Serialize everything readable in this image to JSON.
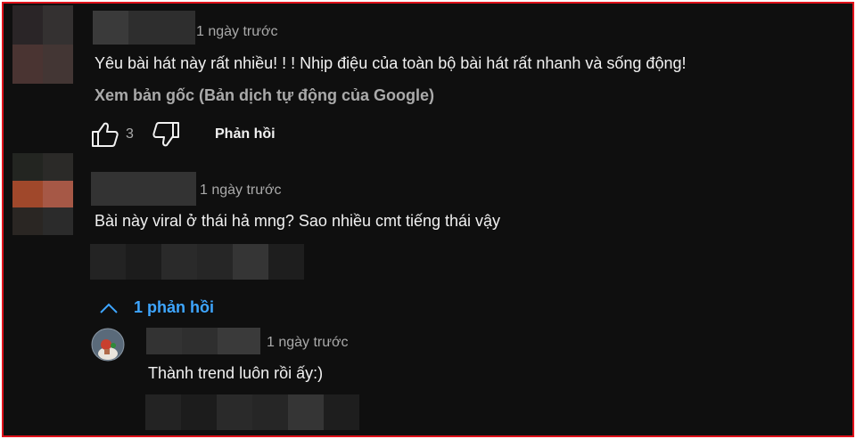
{
  "comments": [
    {
      "timestamp": "1 ngày trước",
      "text": "Yêu bài hát này rất nhiều! ! ! Nhịp điệu của toàn bộ bài hát rất nhanh và sống động!",
      "translation_link": "Xem bản gốc (Bản dịch tự động của Google)",
      "like_count": "3",
      "reply_label": "Phản hồi"
    },
    {
      "timestamp": "1 ngày trước",
      "text": "Bài này viral ở thái hả mng? Sao nhiều cmt tiếng thái vậy",
      "replies_toggle": "1 phản hồi"
    }
  ],
  "reply": {
    "timestamp": "1 ngày trước",
    "text": "Thành trend luôn rồi ấy:)"
  },
  "icons": {
    "like": "thumbs-up-icon",
    "dislike": "thumbs-down-icon",
    "toggle": "chevron-up-icon"
  },
  "colors": {
    "background": "#0f0f0f",
    "frame_border": "#e0121b",
    "link": "#3ea6ff"
  }
}
